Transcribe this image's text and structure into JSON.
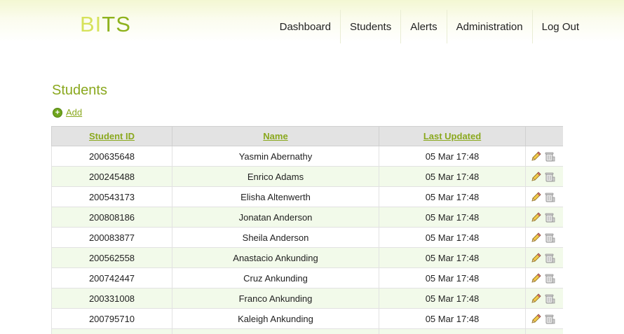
{
  "app": {
    "logo_part1": "BI",
    "logo_part2": "TS"
  },
  "nav": {
    "items": [
      "Dashboard",
      "Students",
      "Alerts",
      "Administration",
      "Log Out"
    ]
  },
  "page": {
    "title": "Students",
    "add_label": "Add"
  },
  "table": {
    "columns": [
      "Student ID",
      "Name",
      "Last Updated"
    ],
    "rows": [
      {
        "id": "200635648",
        "name": "Yasmin Abernathy",
        "updated": "05 Mar 17:48"
      },
      {
        "id": "200245488",
        "name": "Enrico Adams",
        "updated": "05 Mar 17:48"
      },
      {
        "id": "200543173",
        "name": "Elisha Altenwerth",
        "updated": "05 Mar 17:48"
      },
      {
        "id": "200808186",
        "name": "Jonatan Anderson",
        "updated": "05 Mar 17:48"
      },
      {
        "id": "200083877",
        "name": "Sheila Anderson",
        "updated": "05 Mar 17:48"
      },
      {
        "id": "200562558",
        "name": "Anastacio Ankunding",
        "updated": "05 Mar 17:48"
      },
      {
        "id": "200742447",
        "name": "Cruz Ankunding",
        "updated": "05 Mar 17:48"
      },
      {
        "id": "200331008",
        "name": "Franco Ankunding",
        "updated": "05 Mar 17:48"
      },
      {
        "id": "200795710",
        "name": "Kaleigh Ankunding",
        "updated": "05 Mar 17:48"
      }
    ]
  },
  "icons": {
    "add": "add-circle-icon",
    "edit": "pencil-icon",
    "delete": "trash-icon"
  },
  "colors": {
    "accent": "#8aa81e",
    "logo_light": "#d6e25a",
    "row_alt": "#f2faea",
    "header_bg": "#e3e3e3"
  }
}
